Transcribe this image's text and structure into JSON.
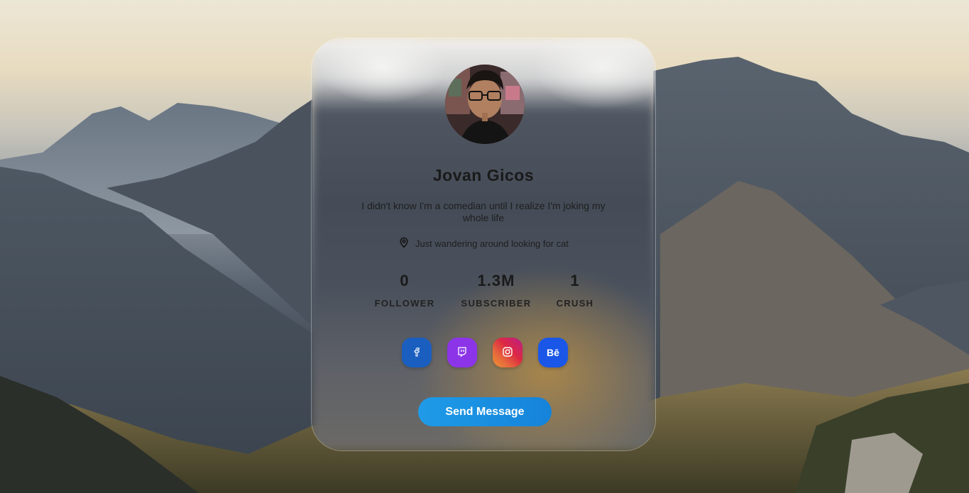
{
  "profile": {
    "name": "Jovan Gicos",
    "bio": "I didn't know I'm a comedian until I realize I'm joking my whole life",
    "location": "Just wandering around looking for cat"
  },
  "stats": [
    {
      "value": "0",
      "label": "FOLLOWER"
    },
    {
      "value": "1.3M",
      "label": "SUBSCRIBER"
    },
    {
      "value": "1",
      "label": "CRUSH"
    }
  ],
  "socials": [
    {
      "name": "facebook",
      "icon": "facebook-icon",
      "color": "#1a5fc0"
    },
    {
      "name": "twitch",
      "icon": "twitch-icon",
      "color": "#8c35e8"
    },
    {
      "name": "instagram",
      "icon": "instagram-icon",
      "color": "#dc2743"
    },
    {
      "name": "behance",
      "icon": "behance-icon",
      "glyph": "Bē",
      "color": "#1a57e8"
    }
  ],
  "actions": {
    "send_label": "Send Message"
  },
  "colors": {
    "button": "#1e9be8"
  }
}
